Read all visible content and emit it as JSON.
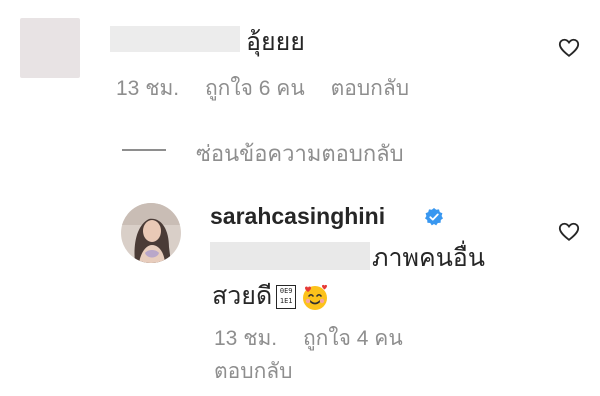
{
  "comment": {
    "text": "อุ้ยยย",
    "time": "13 ชม.",
    "likes": "ถูกใจ 6 คน",
    "reply_label": "ตอบกลับ"
  },
  "replies_toggle": {
    "label": "ซ่อนข้อความตอบกลับ"
  },
  "reply": {
    "username": "sarahcasinghini",
    "text_line1": "ภาพคนอื่น",
    "text_line2": "สวยดี",
    "unrendered_glyph": "0E9\n1E1",
    "time": "13 ชม.",
    "likes": "ถูกใจ 4 คน",
    "reply_label": "ตอบกลับ"
  },
  "colors": {
    "text": "#262626",
    "secondary": "#8e8e8e",
    "verified": "#3897f0"
  },
  "icons": {
    "like": "heart-outline-icon",
    "verified": "verified-badge-icon",
    "emoji": "smiling-face-with-hearts-emoji"
  }
}
